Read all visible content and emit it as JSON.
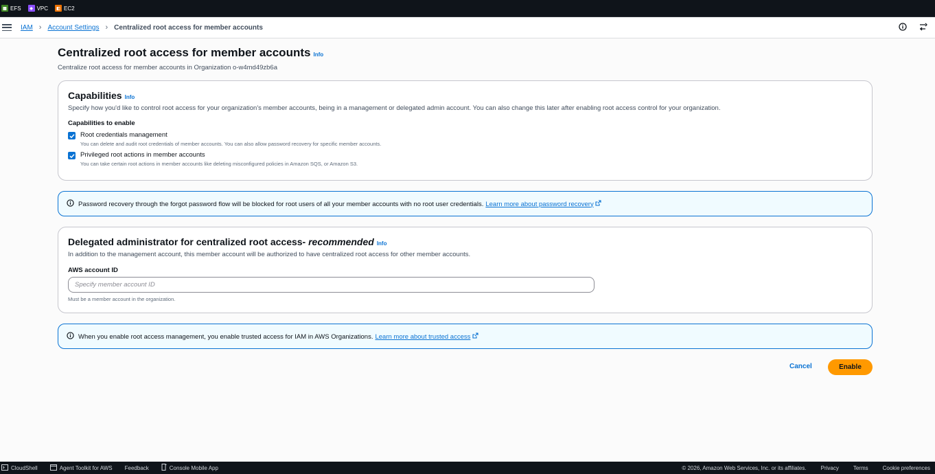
{
  "favorites": [
    {
      "label": "EFS",
      "color": "#3f8624"
    },
    {
      "label": "VPC",
      "color": "#8c4fff"
    },
    {
      "label": "EC2",
      "color": "#ed7100"
    }
  ],
  "breadcrumb": {
    "service": "IAM",
    "parent": "Account Settings",
    "current": "Centralized root access for member accounts"
  },
  "header": {
    "title": "Centralized root access for member accounts",
    "info": "Info",
    "subtitle": "Centralize root access for member accounts in Organization o-w4md49zb6a"
  },
  "capabilities": {
    "title": "Capabilities",
    "info": "Info",
    "description": "Specify how you'd like to control root access for your organization's member accounts, being in a management or delegated admin account. You can also change this later after enabling root access control for your organization.",
    "group_label": "Capabilities to enable",
    "items": [
      {
        "label": "Root credentials management",
        "description": "You can delete and audit root credentials of member accounts. You can also allow password recovery for specific member accounts.",
        "checked": true
      },
      {
        "label": "Privileged root actions in member accounts",
        "description": "You can take certain root actions in member accounts like deleting misconfigured policies in Amazon SQS, or Amazon S3.",
        "checked": true
      }
    ]
  },
  "alert_password": {
    "text": "Password recovery through the forgot password flow will be blocked for root users of all your member accounts with no root user credentials.",
    "link": "Learn more about password recovery"
  },
  "delegated": {
    "title": "Delegated administrator for centralized root access-",
    "title_emphasis": "recommended",
    "info": "Info",
    "description": "In addition to the management account, this member account will be authorized to have centralized root access for other member accounts.",
    "field_label": "AWS account ID",
    "placeholder": "Specify member account ID",
    "value": "",
    "hint": "Must be a member account in the organization."
  },
  "alert_trusted": {
    "text": "When you enable root access management, you enable trusted access for IAM in AWS Organizations.",
    "link": "Learn more about trusted access"
  },
  "actions": {
    "cancel": "Cancel",
    "enable": "Enable"
  },
  "footer": {
    "cloudshell": "CloudShell",
    "agent_toolkit": "Agent Toolkit for AWS",
    "feedback": "Feedback",
    "mobile_app": "Console Mobile App",
    "copyright": "© 2026, Amazon Web Services, Inc. or its affiliates.",
    "privacy": "Privacy",
    "terms": "Terms",
    "cookies": "Cookie preferences"
  },
  "colors": {
    "link": "#0972d3",
    "primary_button": "#ff9900",
    "info_alert_bg": "#f0fbff"
  }
}
